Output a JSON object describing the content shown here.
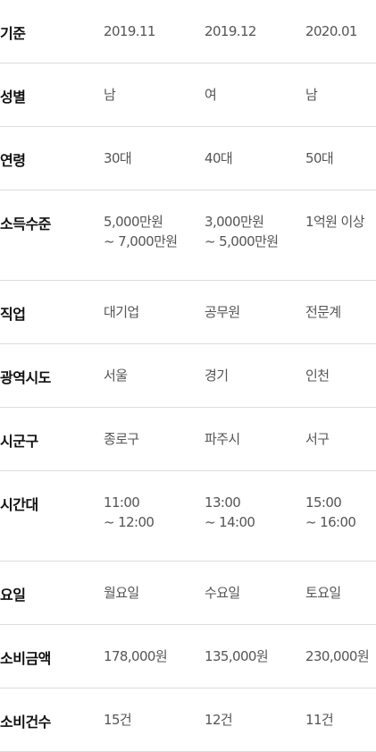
{
  "rows": [
    {
      "label": "기준",
      "values": [
        [
          "2019.11"
        ],
        [
          "2019.12"
        ],
        [
          "2020.01"
        ]
      ]
    },
    {
      "label": "성별",
      "values": [
        [
          "남"
        ],
        [
          "여"
        ],
        [
          "남"
        ]
      ]
    },
    {
      "label": "연령",
      "values": [
        [
          "30대"
        ],
        [
          "40대"
        ],
        [
          "50대"
        ]
      ]
    },
    {
      "label": "소득수준",
      "values": [
        [
          "5,000만원",
          "~ 7,000만원"
        ],
        [
          "3,000만원",
          "~ 5,000만원"
        ],
        [
          "1억원 이상"
        ]
      ]
    },
    {
      "label": "직업",
      "values": [
        [
          "대기업"
        ],
        [
          "공무원"
        ],
        [
          "전문계"
        ]
      ]
    },
    {
      "label": "광역시도",
      "values": [
        [
          "서울"
        ],
        [
          "경기"
        ],
        [
          "인천"
        ]
      ]
    },
    {
      "label": "시군구",
      "values": [
        [
          "종로구"
        ],
        [
          "파주시"
        ],
        [
          "서구"
        ]
      ]
    },
    {
      "label": "시간대",
      "values": [
        [
          "11:00",
          "~ 12:00"
        ],
        [
          "13:00",
          "~ 14:00"
        ],
        [
          "15:00",
          "~ 16:00"
        ]
      ]
    },
    {
      "label": "요일",
      "values": [
        [
          "월요일"
        ],
        [
          "수요일"
        ],
        [
          "토요일"
        ]
      ]
    },
    {
      "label": "소비금액",
      "values": [
        [
          "178,000원"
        ],
        [
          "135,000원"
        ],
        [
          "230,000원"
        ]
      ]
    },
    {
      "label": "소비건수",
      "values": [
        [
          "15건"
        ],
        [
          "12건"
        ],
        [
          "11건"
        ]
      ]
    }
  ]
}
